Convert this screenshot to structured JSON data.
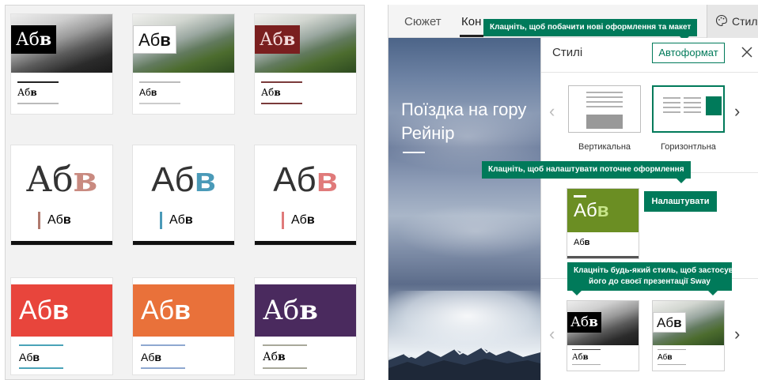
{
  "style_grid": {
    "title_sample": "Аб",
    "title_sample_bold": "в",
    "sub_sample": "Аб",
    "sub_sample_bold": "в",
    "row1": [
      {
        "accent": "#000000",
        "line_color": "#222222",
        "underline_color": "#bbbbbb"
      },
      {
        "accent": "#ffffff",
        "line_color": "#bbbbbb",
        "underline_color": "#cccccc"
      },
      {
        "accent": "#7a1f1f",
        "line_color": "#7a3a3a",
        "underline_color": "#7a3a3a"
      }
    ],
    "row2": [
      {
        "title_color": "#333333",
        "bold_color": "#c98a80",
        "bar_color": "#b07a6e"
      },
      {
        "title_color": "#333333",
        "bold_color": "#4a9ab8",
        "bar_color": "#4a9ab8"
      },
      {
        "title_color": "#333333",
        "bold_color": "#e07a7a",
        "bar_color": "#e07a7a"
      }
    ],
    "row3": [
      {
        "block_color": "#e8453c",
        "line_color": "#4aa3b8"
      },
      {
        "block_color": "#e9713a",
        "line_color": "#8ea8d0"
      },
      {
        "block_color": "#4a2a5e",
        "line_color": "#a8a89a"
      }
    ]
  },
  "sway": {
    "tabs": {
      "storyline": "Сюжет",
      "content_truncated": "Кон"
    },
    "styles_button_label": "Стилі",
    "tooltip_new_designs": "Клацніть, щоб побачити нові оформлення та макет",
    "tooltip_customize": "Клацніть, щоб налаштувати поточне оформлення",
    "tooltip_apply_line1": "Клацніть будь-який стиль, щоб застосувати",
    "tooltip_apply_line2": "його до своєї презентації Sway",
    "preview_title": "Поїздка на гору Рейнір",
    "panel_title": "Стилі",
    "autoformat_label": "Автоформат",
    "layouts": [
      {
        "label": "Вертикальна"
      },
      {
        "label": "Горизонтльна"
      }
    ],
    "customize_label": "Налаштувати",
    "current_style": {
      "title": "Аб",
      "title_bold": "в",
      "sub": "Аб",
      "sub_bold": "в",
      "color": "#6b8e23"
    },
    "style_options": [
      {
        "title": "Аб",
        "title_bold": "в",
        "sub": "Аб",
        "sub_bold": "в"
      },
      {
        "title": "Аб",
        "title_bold": "в",
        "sub": "Аб",
        "sub_bold": "в"
      }
    ],
    "accent_color": "#007a5a"
  }
}
